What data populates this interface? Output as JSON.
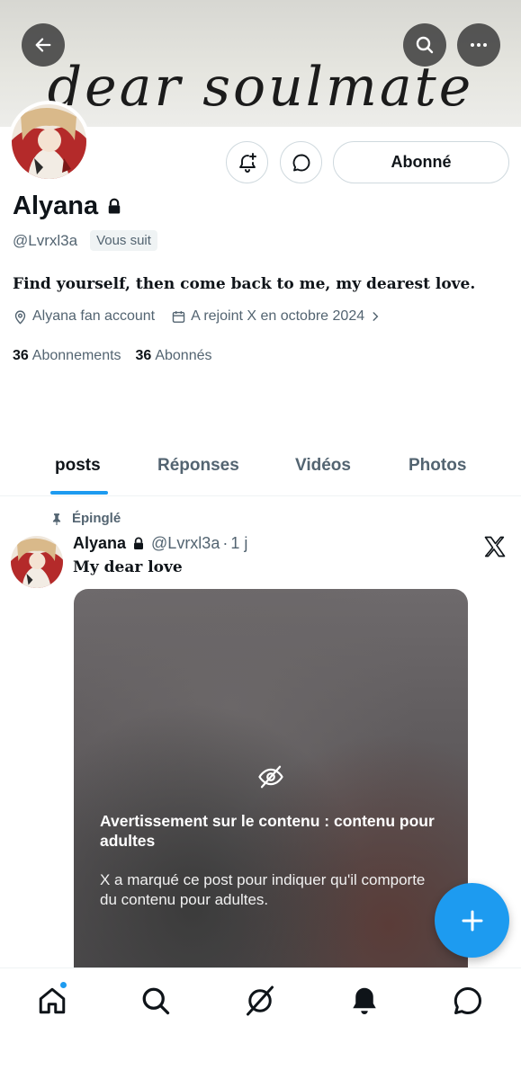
{
  "header": {
    "banner_text": "dear soulmate",
    "back_icon": "arrow-left-icon",
    "search_icon": "search-icon",
    "more_icon": "more-horizontal-icon"
  },
  "profile": {
    "name": "Alyana",
    "locked_icon": "lock-icon",
    "handle": "@Lvrxl3a",
    "follows_you": "Vous suit",
    "bio": "Find yourself, then come back to me, my dearest love.",
    "location": "Alyana fan account",
    "joined": "A rejoint X en octobre 2024",
    "following_count": "36",
    "following_label": "Abonnements",
    "followers_count": "36",
    "followers_label": "Abonnés",
    "follow_button": "Abonné"
  },
  "tabs": [
    {
      "label": "posts"
    },
    {
      "label": "Réponses"
    },
    {
      "label": "Vidéos"
    },
    {
      "label": "Photos"
    }
  ],
  "post": {
    "pinned_label": "Épinglé",
    "author": "Alyana",
    "handle": "@Lvrxl3a",
    "dot": "·",
    "time": "1 j",
    "text": "My dear love",
    "warning_title": "Avertissement sur le contenu : contenu pour adultes",
    "warning_body": "X a marqué ce post pour indiquer qu'il comporte du contenu pour adultes."
  },
  "colors": {
    "accent": "#1d9bf0",
    "text_primary": "#0f1419",
    "text_secondary": "#536471"
  }
}
